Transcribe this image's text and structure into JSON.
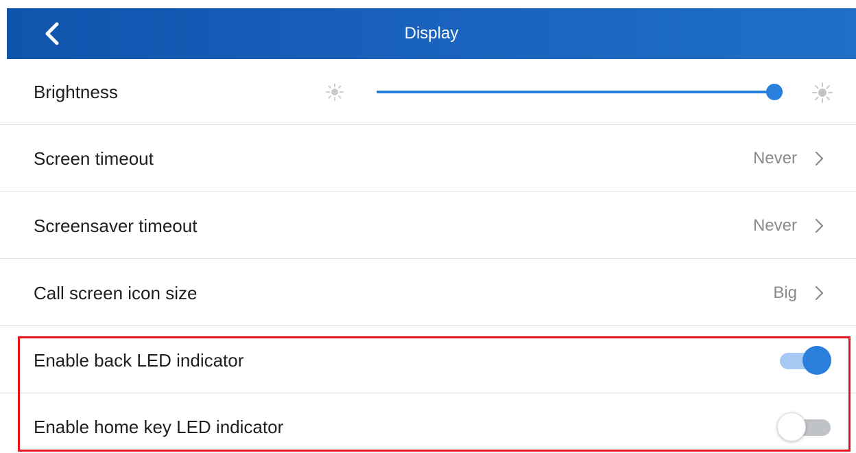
{
  "header": {
    "title": "Display",
    "back_icon": "chevron-left-icon"
  },
  "brightness": {
    "label": "Brightness",
    "level_percent": 100,
    "min_icon": "sun-dim-icon",
    "max_icon": "sun-bright-icon",
    "accent_color": "#2a7fdc"
  },
  "settings": [
    {
      "label": "Screen timeout",
      "value": "Never"
    },
    {
      "label": "Screensaver timeout",
      "value": "Never"
    },
    {
      "label": "Call screen icon size",
      "value": "Big"
    }
  ],
  "toggles": [
    {
      "label": "Enable back LED indicator",
      "enabled": true
    },
    {
      "label": "Enable home key LED indicator",
      "enabled": false
    }
  ],
  "colors": {
    "header_bg": "#1a63be",
    "accent": "#2a7fdc",
    "highlight_border": "#e8141e"
  }
}
